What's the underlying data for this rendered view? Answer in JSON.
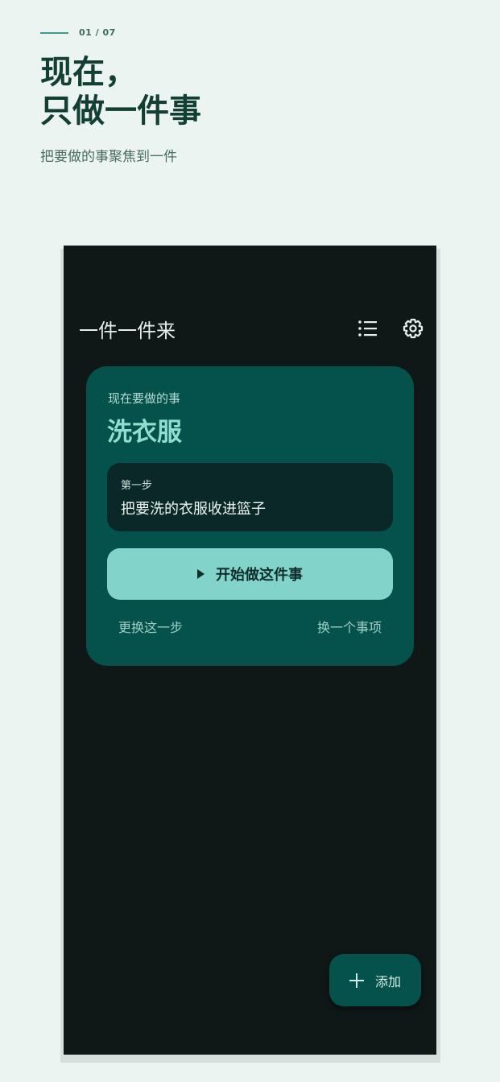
{
  "intro": {
    "page_counter": "01 / 07",
    "headline_line1": "现在，",
    "headline_line2": "只做一件事",
    "subline": "把要做的事聚焦到一件"
  },
  "app": {
    "title": "一件一件来",
    "list_icon": "list-icon",
    "settings_icon": "gear-icon"
  },
  "card": {
    "label": "现在要做的事",
    "task": "洗衣服",
    "step_label": "第一步",
    "step_text": "把要洗的衣服收进篮子",
    "start_label": "开始做这件事",
    "change_step_label": "更换这一步",
    "change_item_label": "换一个事项"
  },
  "fab": {
    "label": "添加",
    "icon": "plus-icon"
  },
  "colors": {
    "background": "#ebf4f0",
    "phone_bg": "#0f1717",
    "card_bg": "#04524b",
    "accent": "#82d4ca",
    "task_text": "#8fdfcf"
  }
}
